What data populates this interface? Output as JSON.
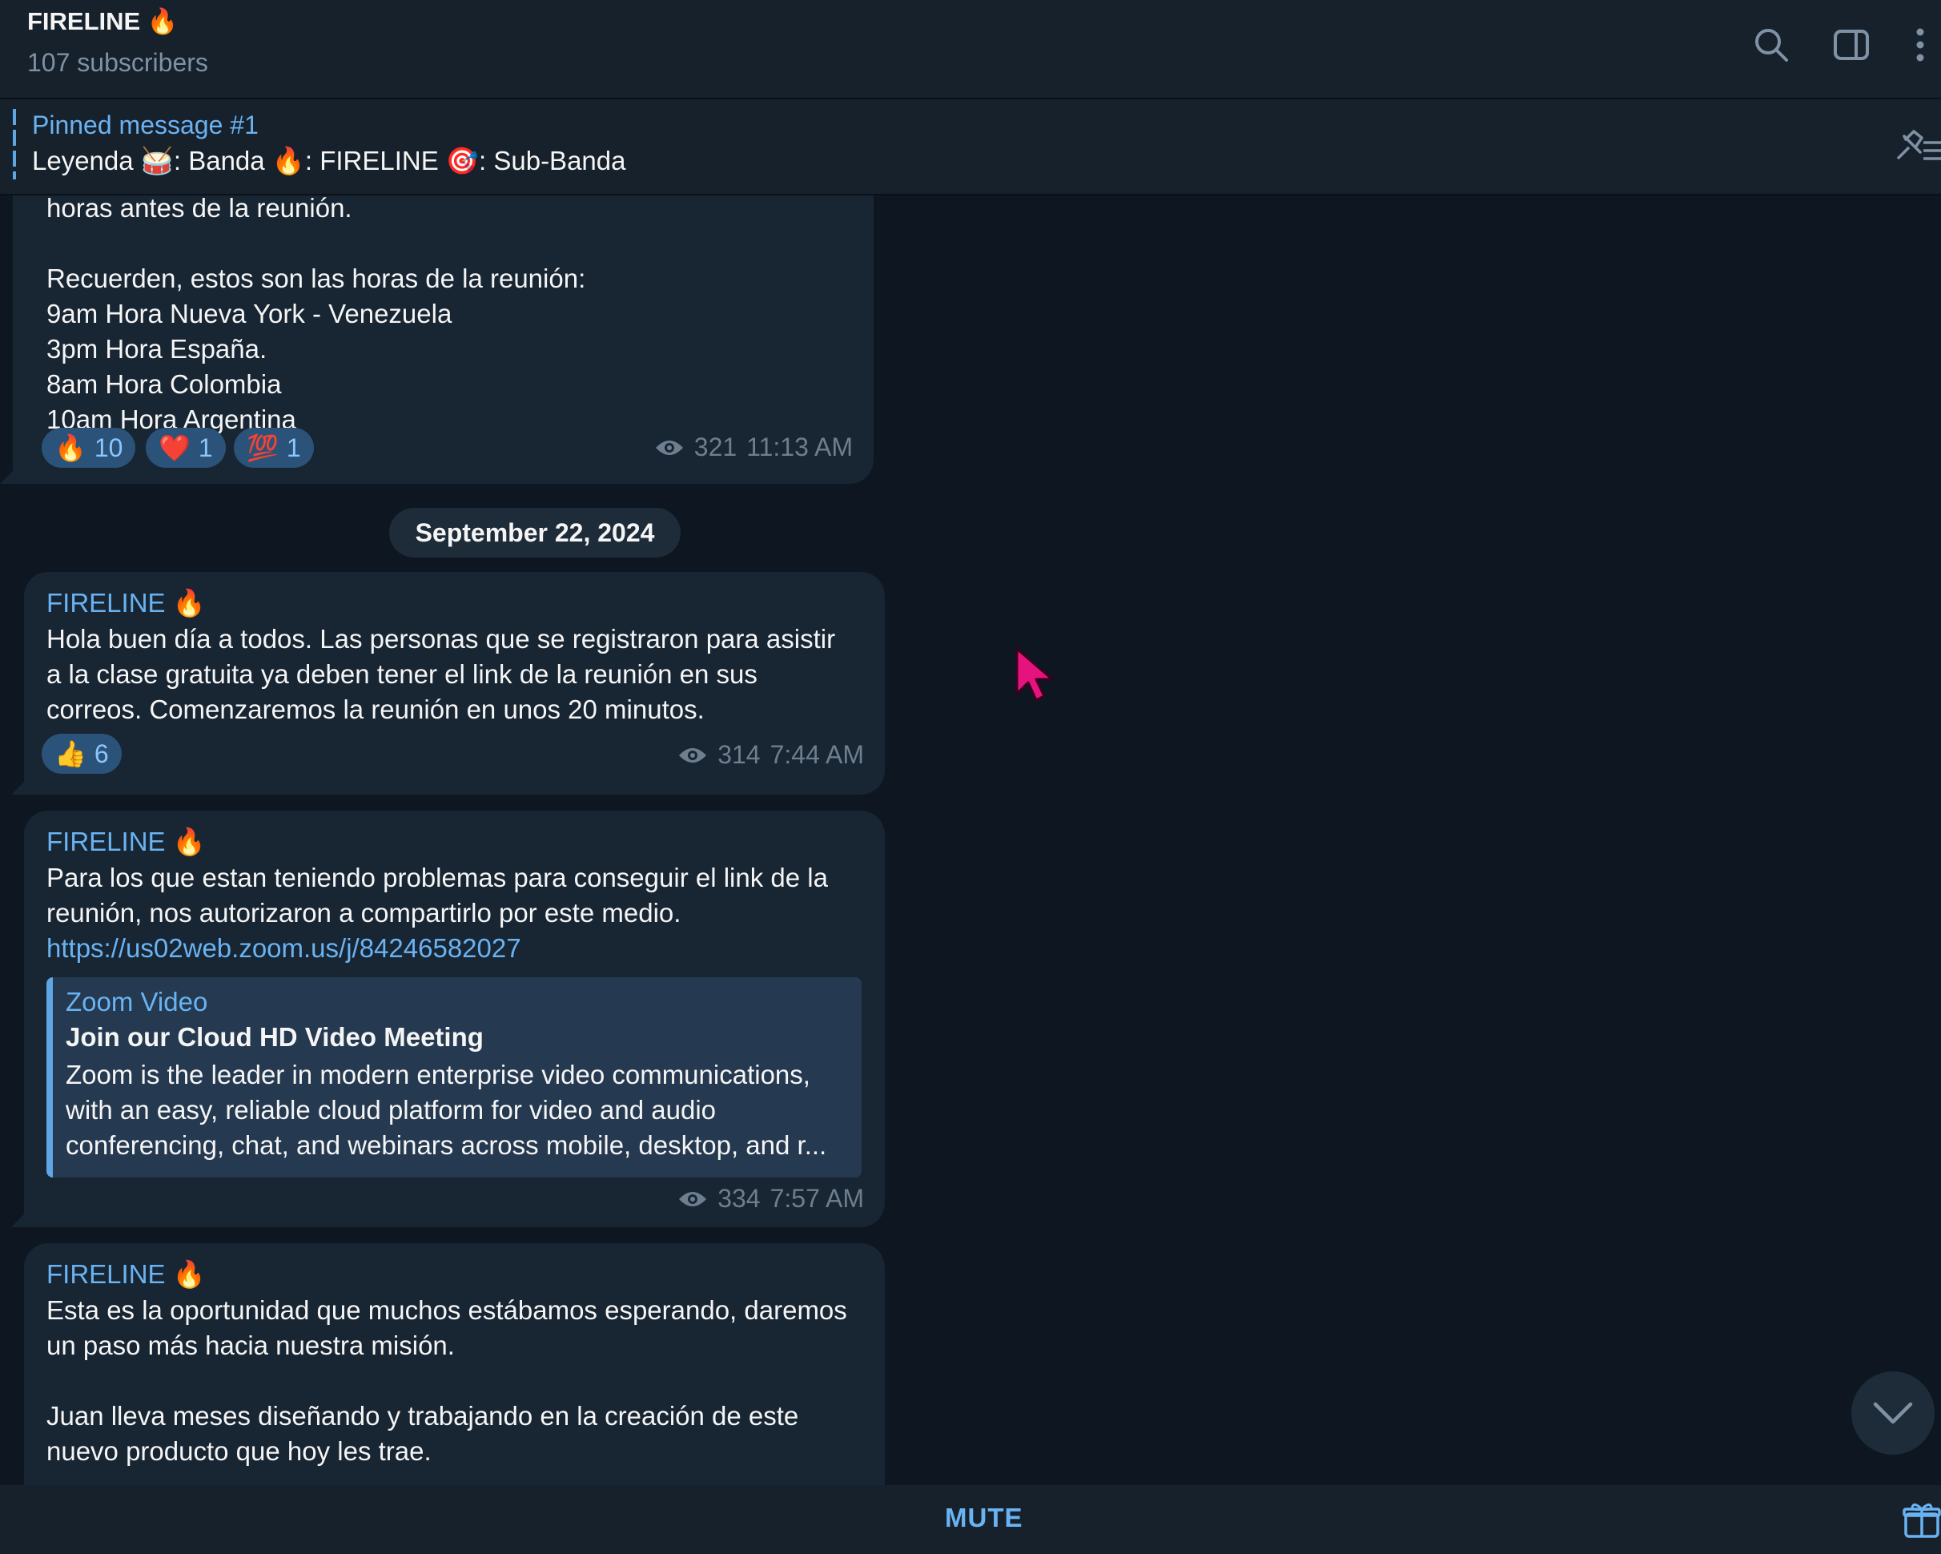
{
  "header": {
    "title": "FIRELINE 🔥",
    "subtitle": "107 subscribers",
    "icons": [
      "search-icon",
      "sidebar-toggle-icon",
      "more-vertical-icon"
    ]
  },
  "pinned": {
    "label": "Pinned message #1",
    "text": "Leyenda 🥁: Banda  🔥: FIRELINE  🎯: Sub-Banda"
  },
  "messages": [
    {
      "partial_top": "horas antes de la reunión.",
      "text": "Recuerden, estos son las horas de la reunión:\n9am Hora Nueva York - Venezuela\n3pm Hora España.\n8am Hora Colombia\n10am Hora Argentina",
      "reactions": [
        {
          "emoji": "🔥",
          "count": "10"
        },
        {
          "emoji": "❤️",
          "count": "1"
        },
        {
          "emoji": "💯",
          "count": "1"
        }
      ],
      "views": "321",
      "time": "11:13 AM"
    },
    {
      "author": "FIRELINE 🔥",
      "text": "Hola buen día a todos. Las personas que se registraron para asistir\na la clase gratuita ya deben tener el link de la reunión en sus\ncorreos. Comenzaremos la reunión en unos 20 minutos.",
      "reactions": [
        {
          "emoji": "👍",
          "count": "6"
        }
      ],
      "views": "314",
      "time": "7:44 AM"
    },
    {
      "author": "FIRELINE 🔥",
      "text": "Para los que estan teniendo problemas para conseguir el link de la\nreunión, nos autorizaron a compartirlo por este medio.",
      "link": "https://us02web.zoom.us/j/84246582027",
      "preview": {
        "site": "Zoom Video",
        "title": "Join our Cloud HD Video Meeting",
        "description": "Zoom is the leader in modern enterprise video communications, with an easy, reliable cloud platform for video and audio conferencing, chat, and webinars across mobile, desktop, and r..."
      },
      "views": "334",
      "time": "7:57 AM"
    },
    {
      "author": "FIRELINE 🔥",
      "text": "Esta es la oportunidad que muchos estábamos esperando, daremos\nun paso más hacia nuestra misión.\n\nJuan lleva meses diseñando y trabajando en la creación de este\nnuevo producto que hoy les trae."
    }
  ],
  "date_separator": "September 22, 2024",
  "bottom": {
    "mute_label": "MUTE",
    "icons": [
      "gift-icon",
      "scroll-down-icon"
    ]
  },
  "colors": {
    "background": "#0e1621",
    "panel": "#17212b",
    "bubble": "#182533",
    "accent": "#6ab3f3"
  }
}
